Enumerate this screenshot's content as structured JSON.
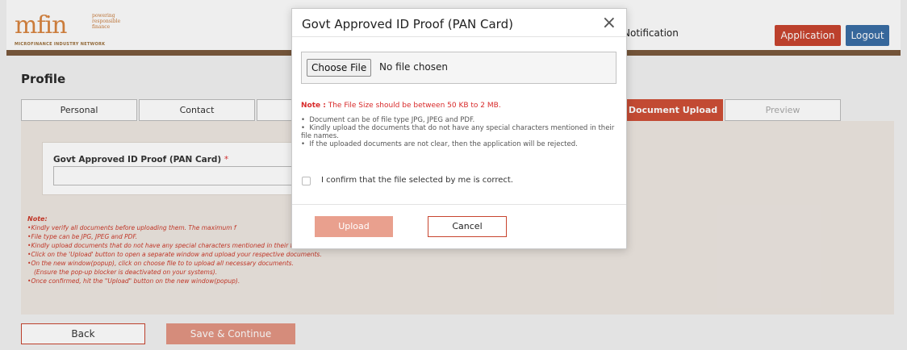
{
  "header": {
    "logo_text": "mfin",
    "logo_tagline": [
      "powering",
      "responsible",
      "finance"
    ],
    "logo_network": "MICROFINANCE INDUSTRY NETWORK",
    "notification_label": "Notification",
    "application_label": "Application",
    "logout_label": "Logout"
  },
  "page": {
    "title": "Profile",
    "tabs": [
      {
        "label": "Personal"
      },
      {
        "label": "Contact"
      },
      {
        "label": "Document Upload",
        "active": true
      },
      {
        "label": "Preview"
      }
    ],
    "field_label": "Govt Approved ID Proof (PAN Card)",
    "field_required_mark": "*",
    "note_heading": "Note:",
    "notes": [
      "Kindly verify all documents before uploading them. The maximum f",
      "File type can be JPG, JPEG and PDF.",
      "Kindly upload documents that do not have any special characters mentioned in their file names.",
      "Click on the 'Upload' button to open a separate window and upload your respective documents.",
      "On the new window(popup), click on choose file to to upload all necessary documents.",
      "(Ensure the pop-up blocker is deactivated on your systems).",
      "Once confirmed, hit the \"Upload\" button on the new window(popup)."
    ],
    "back_label": "Back",
    "save_label": "Save & Continue"
  },
  "modal": {
    "title": "Govt Approved ID Proof (PAN Card)",
    "close_glyph": "×",
    "choose_file_label": "Choose File",
    "no_file_text": "No file chosen",
    "note_prefix": "Note :",
    "note_text": " The File Size should be between 50 KB to 2 MB.",
    "instructions": [
      "Document can be of file type JPG, JPEG and PDF.",
      "Kindly upload the documents that do not have any special characters mentioned in their file names.",
      "If the uploaded documents are not clear, then the application will be rejected."
    ],
    "confirm_label": "I confirm that the file selected by me is correct.",
    "upload_label": "Upload",
    "cancel_label": "Cancel"
  },
  "colors": {
    "accent": "#c8452f",
    "brand": "#d8843f",
    "logout": "#3a6ea5",
    "note_red": "#d82a2a"
  }
}
